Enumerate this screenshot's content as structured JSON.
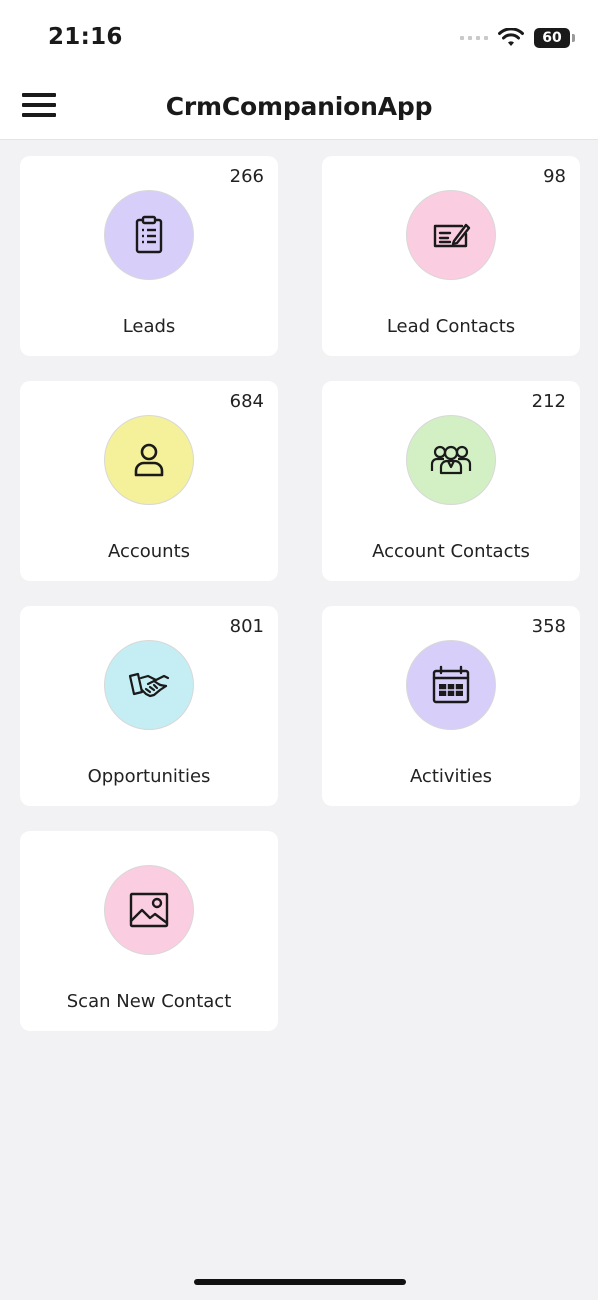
{
  "status_bar": {
    "time": "21:16",
    "battery": "60",
    "icons": [
      "signal-dots-icon",
      "wifi-icon",
      "battery-icon"
    ]
  },
  "header": {
    "title": "CrmCompanionApp",
    "menu_icon": "hamburger-menu-icon"
  },
  "tiles": [
    {
      "label": "Leads",
      "count": "266",
      "icon": "clipboard-icon",
      "color": "#d7cef9"
    },
    {
      "label": "Lead Contacts",
      "count": "98",
      "icon": "signed-card-icon",
      "color": "#fbcde0"
    },
    {
      "label": "Accounts",
      "count": "684",
      "icon": "person-icon",
      "color": "#f4f19a"
    },
    {
      "label": "Account Contacts",
      "count": "212",
      "icon": "group-icon",
      "color": "#d2f0c4"
    },
    {
      "label": "Opportunities",
      "count": "801",
      "icon": "handshake-icon",
      "color": "#c4eef4"
    },
    {
      "label": "Activities",
      "count": "358",
      "icon": "calendar-icon",
      "color": "#d7cef9"
    },
    {
      "label": "Scan New Contact",
      "count": "",
      "icon": "image-icon",
      "color": "#fbcde0"
    }
  ]
}
